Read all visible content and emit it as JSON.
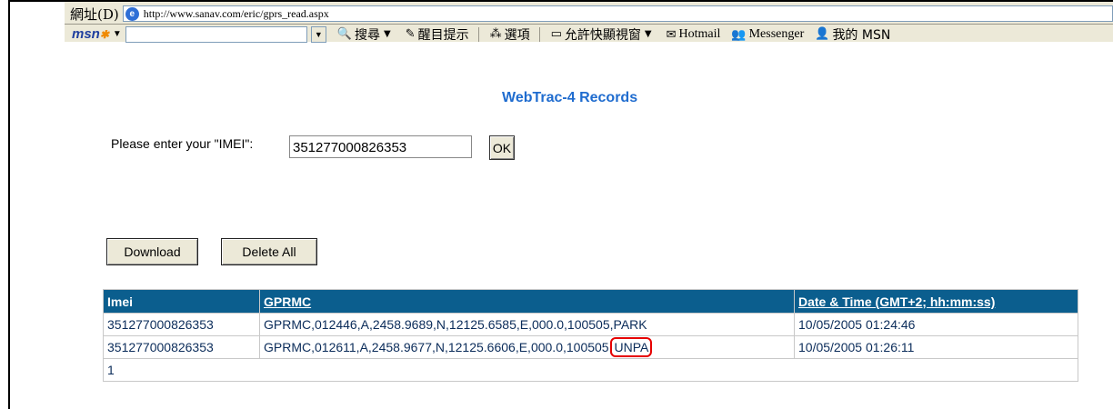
{
  "browser": {
    "address_label": "網址(D)",
    "url": "http://www.sanav.com/eric/gprs_read.aspx",
    "toolbar": {
      "msn_logo": "msn",
      "search_value": "",
      "search_label": "搜尋",
      "highlight_label": "醒目提示",
      "options_label": "選項",
      "popup_label": "允許快顯視窗",
      "hotmail_label": "Hotmail",
      "messenger_label": "Messenger",
      "mymsn_label": "我的 MSN"
    }
  },
  "page": {
    "title": "WebTrac-4 Records",
    "imei_label": "Please enter your \"IMEI\":",
    "imei_value": "351277000826353",
    "ok_label": "OK",
    "download_label": "Download",
    "delete_all_label": "Delete All"
  },
  "table": {
    "headers": [
      "Imei",
      "GPRMC",
      "Date & Time (GMT+2; hh:mm:ss)"
    ],
    "rows": [
      {
        "imei": "351277000826353",
        "gprmc": "GPRMC,012446,A,2458.9689,N,12125.6585,E,000.0,100505,PARK",
        "datetime": "10/05/2005 01:24:46"
      },
      {
        "imei": "351277000826353",
        "gprmc_prefix": "GPRMC,012611,A,2458.9677,N,12125.6606,E,000.0,100505,",
        "gprmc_highlight": "UNPA",
        "datetime": "10/05/2005 01:26:11"
      }
    ],
    "pager": "1"
  },
  "colors": {
    "header_bg": "#0b5e8e",
    "title": "#1f6ccf",
    "highlight": "#e60000"
  }
}
